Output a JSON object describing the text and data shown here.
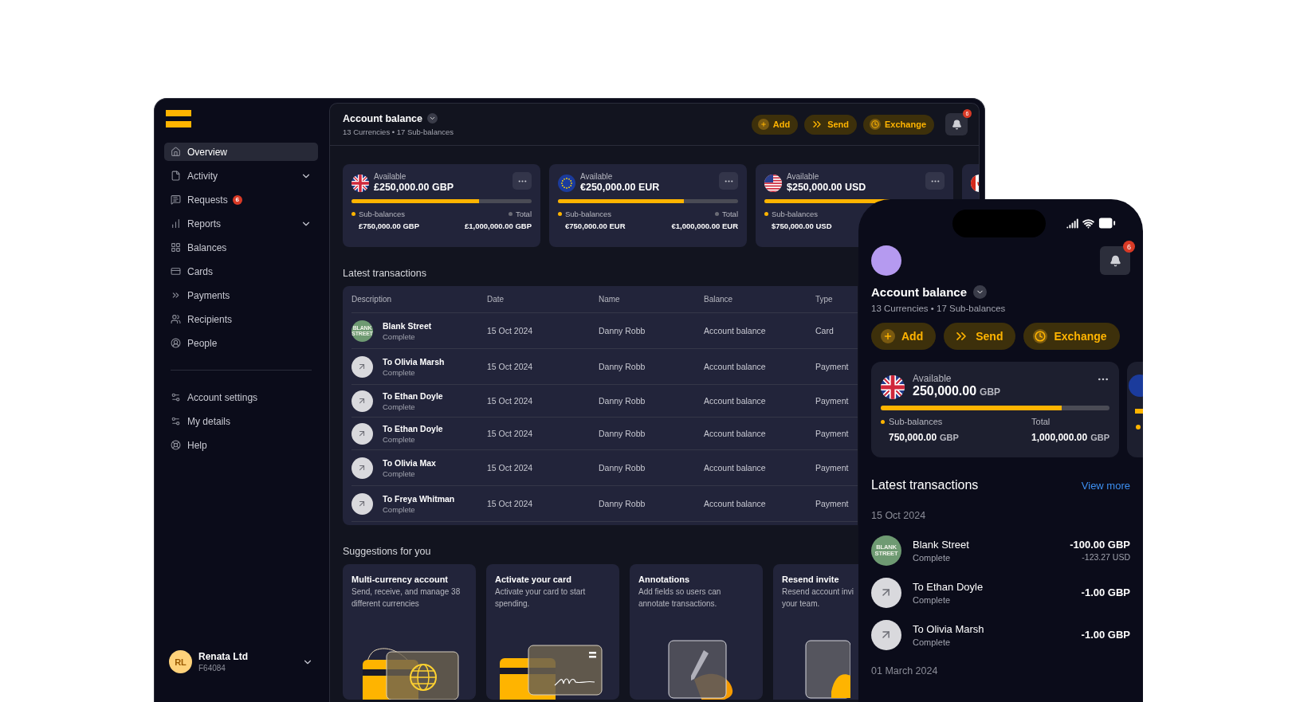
{
  "sidebar": {
    "nav": [
      {
        "label": "Overview",
        "selected": true,
        "expandable": false
      },
      {
        "label": "Activity",
        "selected": false,
        "expandable": true
      },
      {
        "label": "Requests",
        "selected": false,
        "expandable": false,
        "badge": "6"
      },
      {
        "label": "Reports",
        "selected": false,
        "expandable": true
      },
      {
        "label": "Balances",
        "selected": false,
        "expandable": false
      },
      {
        "label": "Cards",
        "selected": false,
        "expandable": false
      },
      {
        "label": "Payments",
        "selected": false,
        "expandable": false
      },
      {
        "label": "Recipients",
        "selected": false,
        "expandable": false
      },
      {
        "label": "People",
        "selected": false,
        "expandable": false
      }
    ],
    "secondary": [
      {
        "label": "Account settings",
        "selected": false
      },
      {
        "label": "My details",
        "selected": false
      },
      {
        "label": "Help",
        "selected": false
      }
    ],
    "account": {
      "initials": "RL",
      "name": "Renata Ltd",
      "id": "F64084"
    }
  },
  "header": {
    "title": "Account balance",
    "subtitle": "13 Currencies • 17 Sub-balances",
    "actions": [
      "Add",
      "Send",
      "Exchange"
    ],
    "notifications": "6"
  },
  "balances": [
    {
      "kind": "full",
      "label": "Available",
      "amount": "£250,000.00 GBP",
      "level": 0.71,
      "sub_label": "Sub-balances",
      "sub_amount": "£750,000.00 GBP",
      "total_label": "Total",
      "total_amount": "£1,000,000.00 GBP"
    },
    {
      "kind": "full",
      "label": "Available",
      "amount": "€250,000.00 EUR",
      "level": 0.7,
      "sub_label": "Sub-balances",
      "sub_amount": "€750,000.00 EUR",
      "total_label": "Total",
      "total_amount": "€1,000,000.00 EUR"
    },
    {
      "kind": "full",
      "label": "Available",
      "amount": "$250,000.00 USD",
      "level": 0.7,
      "sub_label": "Sub-balances",
      "sub_amount": "$750,000.00 USD"
    },
    {
      "kind": "partial"
    }
  ],
  "transactions": {
    "title": "Latest transactions",
    "columns": [
      "Description",
      "Date",
      "Name",
      "Balance",
      "Type"
    ],
    "rows": [
      {
        "kind": "merchant",
        "logo": "BLANK STREET",
        "description": "Blank Street",
        "status": "Complete",
        "date": "15 Oct 2024",
        "name": "Danny Robb",
        "balance": "Account balance",
        "type": "Card"
      },
      {
        "kind": "transfer",
        "description": "To Olivia Marsh",
        "status": "Complete",
        "date": "15 Oct 2024",
        "name": "Danny Robb",
        "balance": "Account balance",
        "type": "Payment"
      },
      {
        "kind": "transfer",
        "description": "To Ethan Doyle",
        "status": "Complete",
        "date": "15 Oct 2024",
        "name": "Danny Robb",
        "balance": "Account balance",
        "type": "Payment"
      },
      {
        "kind": "transfer",
        "description": "To Ethan Doyle",
        "status": "Complete",
        "date": "15 Oct 2024",
        "name": "Danny Robb",
        "balance": "Account balance",
        "type": "Payment"
      },
      {
        "kind": "transfer",
        "description": "To Olivia Max",
        "status": "Complete",
        "date": "15 Oct 2024",
        "name": "Danny Robb",
        "balance": "Account balance",
        "type": "Payment"
      },
      {
        "kind": "transfer",
        "description": "To Freya Whitman",
        "status": "Complete",
        "date": "15 Oct 2024",
        "name": "Danny Robb",
        "balance": "Account balance",
        "type": "Payment"
      }
    ]
  },
  "suggestions": {
    "title": "Suggestions for you",
    "items": [
      {
        "title": "Multi-currency account",
        "lines": [
          "Send, receive, and manage 38",
          "different currencies"
        ]
      },
      {
        "title": "Activate your card",
        "lines": [
          "Activate your card to start",
          "spending."
        ]
      },
      {
        "title": "Annotations",
        "lines": [
          "Add fields so users can",
          "annotate transactions."
        ]
      },
      {
        "title": "Resend invite",
        "lines": [
          "Resend account invi",
          "your team."
        ]
      }
    ]
  },
  "phone": {
    "title": "Account balance",
    "subtitle": "13 Currencies • 17 Sub-balances",
    "actions": [
      "Add",
      "Send",
      "Exchange"
    ],
    "notifications": "6",
    "balance": {
      "label": "Available",
      "amount": "250,000.00",
      "currency": "GBP",
      "level": 0.79,
      "sub_label": "Sub-balances",
      "sub_amount": "750,000.00",
      "sub_currency": "GBP",
      "total_label": "Total",
      "total_amount": "1,000,000.00",
      "total_currency": "GBP"
    },
    "transactions": {
      "title": "Latest transactions",
      "link": "View more",
      "groups": [
        {
          "date": "15 Oct 2024",
          "items": [
            {
              "kind": "merchant",
              "logo": "BLANK STREET",
              "name": "Blank Street",
              "status": "Complete",
              "amount": "-100.00 GBP",
              "secondary_amount": "-123.27 USD"
            },
            {
              "kind": "transfer",
              "name": "To Ethan Doyle",
              "status": "Complete",
              "amount": "-1.00 GBP"
            },
            {
              "kind": "transfer",
              "name": "To Olivia Marsh",
              "status": "Complete",
              "amount": "-1.00 GBP"
            }
          ]
        },
        {
          "date": "01 March 2024"
        }
      ]
    }
  }
}
